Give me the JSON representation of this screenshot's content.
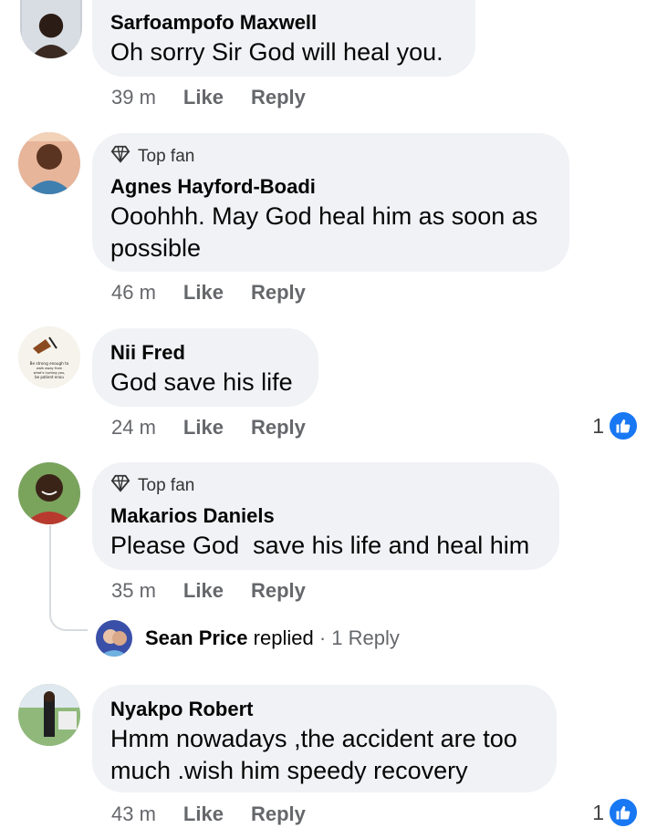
{
  "comments": [
    {
      "name": "Sarfoampofo Maxwell",
      "top_fan": "",
      "text_lines": [
        "Oh sorry Sir God will heal you."
      ],
      "time": "39 m",
      "like": "Like",
      "reply": "Reply"
    },
    {
      "name": "Agnes Hayford-Boadi",
      "top_fan": "Top fan",
      "text_lines": [
        "Ooohhh. May God heal him as soon as",
        "possible"
      ],
      "time": "46 m",
      "like": "Like",
      "reply": "Reply"
    },
    {
      "name": "Nii Fred",
      "top_fan": "",
      "text_lines": [
        "God save his life"
      ],
      "time": "24 m",
      "like": "Like",
      "reply": "Reply",
      "reaction_count": "1"
    },
    {
      "name": "Makarios Daniels",
      "top_fan": "Top fan",
      "text_lines": [
        "Please God  save his life and heal him"
      ],
      "time": "35 m",
      "like": "Like",
      "reply": "Reply"
    },
    {
      "name": "Nyakpo Robert",
      "top_fan": "",
      "text_lines": [
        "Hmm nowadays ,the accident are too",
        "much .wish him speedy recovery"
      ],
      "time": "43 m",
      "like": "Like",
      "reply": "Reply",
      "reaction_count": "1"
    }
  ],
  "reply_summary": {
    "name": "Sean Price",
    "verb": "replied",
    "separator": "·",
    "count": "1 Reply"
  },
  "avatar_text": {
    "line1": "Be strong enough to",
    "line2": "walk away from",
    "line3": "what's hurting you,",
    "line4": "be patient enou"
  },
  "colors": {
    "bubble": "#f0f2f5",
    "meta": "#65676b",
    "like_blue": "#1877f2"
  },
  "icons": [
    "diamond-icon",
    "thumbs-up-icon"
  ]
}
